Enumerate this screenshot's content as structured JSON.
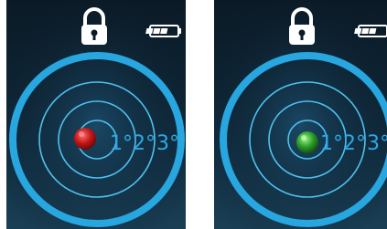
{
  "screens": [
    {
      "id": "left",
      "status": "off-level",
      "bubble_color": "#c41818",
      "bubble_highlight": "#ff5a5a",
      "lock_icon": "lock-icon",
      "battery_icon": "battery-icon",
      "labels": [
        "1°",
        "2°",
        "3°"
      ]
    },
    {
      "id": "right",
      "status": "level",
      "bubble_color": "#2e9e2a",
      "bubble_highlight": "#8ef07a",
      "lock_icon": "lock-icon",
      "battery_icon": "battery-icon",
      "labels": [
        "1°",
        "2°",
        "3°"
      ]
    }
  ],
  "colors": {
    "ring": "#27a6e0",
    "ring_inner": "#4ec0ee",
    "icon": "#ffffff",
    "battery": "#ffffff"
  }
}
